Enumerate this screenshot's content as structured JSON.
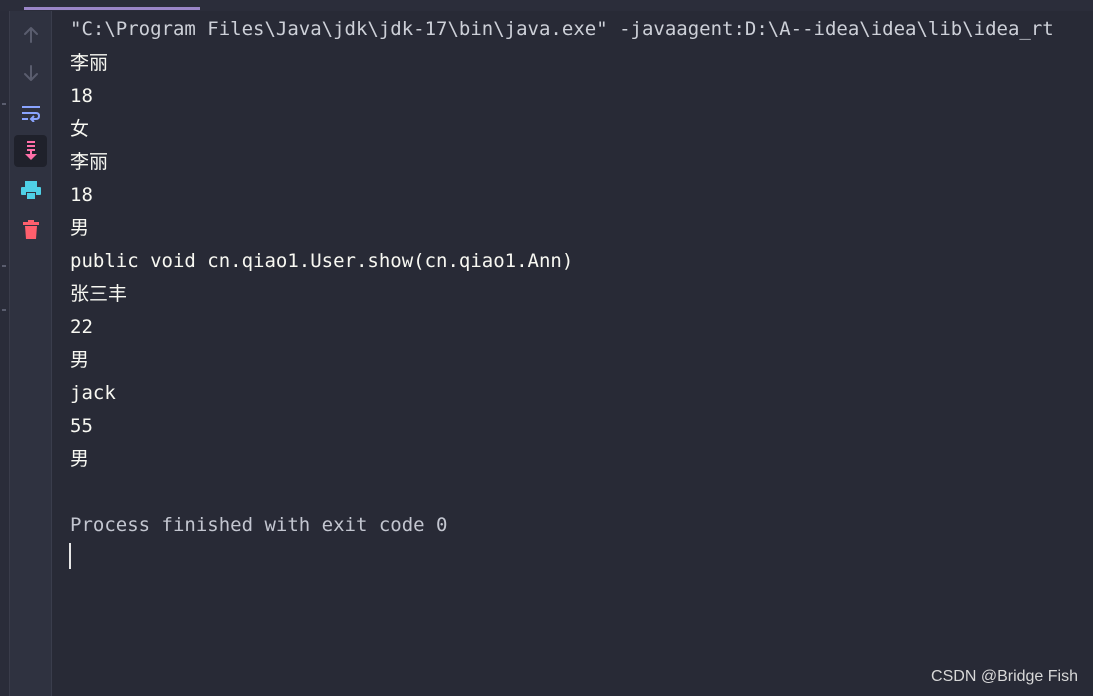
{
  "console": {
    "command_line": "\"C:\\Program Files\\Java\\jdk\\jdk-17\\bin\\java.exe\" -javaagent:D:\\A--idea\\idea\\lib\\idea_rt",
    "output_lines": [
      "李丽",
      "18",
      "女",
      "李丽",
      "18",
      "男",
      "public void cn.qiao1.User.show(cn.qiao1.Ann)",
      "张三丰",
      "22",
      "男",
      "jack",
      "55",
      "男"
    ],
    "process_message": "Process finished with exit code 0"
  },
  "toolbar": {
    "icons": [
      "arrow-up-icon",
      "arrow-down-icon",
      "soft-wrap-icon",
      "scroll-to-end-icon",
      "print-icon",
      "trash-icon"
    ],
    "colors": {
      "disabled": "#5a5d6e",
      "wrap": "#8aa4ff",
      "scroll": "#ff6fa8",
      "print": "#4fd0e6",
      "trash": "#ff5f6d"
    }
  },
  "watermark": {
    "text": "CSDN @Bridge Fish"
  }
}
